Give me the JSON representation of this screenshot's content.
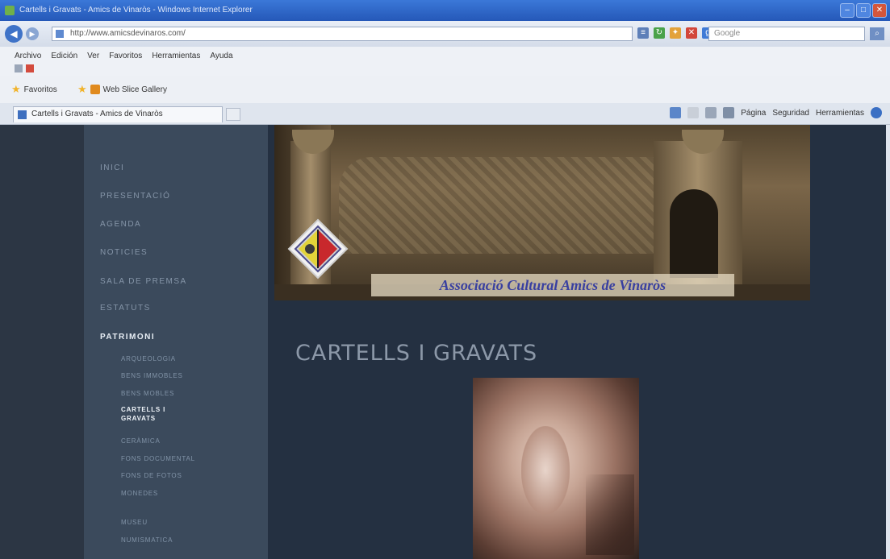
{
  "browser": {
    "window_title": "Cartells i Gravats - Amics de Vinaròs - Windows Internet Explorer",
    "address": "http://www.amicsdevinaros.com/",
    "search_placeholder": "Google",
    "menu": [
      "Archivo",
      "Edición",
      "Ver",
      "Favoritos",
      "Herramientas",
      "Ayuda"
    ],
    "favorites_label": "Favoritos",
    "favorites_item": "Web Slice Gallery",
    "tab_title": "Cartells i Gravats - Amics de Vinaròs",
    "commands": [
      "Página",
      "Seguridad",
      "Herramientas"
    ]
  },
  "sidebar": {
    "items": [
      "INICI",
      "PRESENTACIÓ",
      "AGENDA",
      "NOTICIES",
      "SALA DE PREMSA",
      "ESTATUTS",
      "PATRIMONI"
    ],
    "subitems": [
      "ARQUEOLOGIA",
      "BENS IMMOBLES",
      "BENS MOBLES",
      "CARTELLS I GRAVATS",
      "CERÀMICA",
      "FONS DOCUMENTAL",
      "FONS DE FOTOS",
      "MONEDES",
      "MUSEU",
      "NUMISMATICA"
    ]
  },
  "banner": {
    "tagline": "Associació Cultural Amics de Vinaròs"
  },
  "main": {
    "title": "CARTELLS I GRAVATS"
  },
  "colors": {
    "sidebar_bg": "#3b4a5c",
    "content_bg": "#243041",
    "title_text": "#8c98a8"
  }
}
